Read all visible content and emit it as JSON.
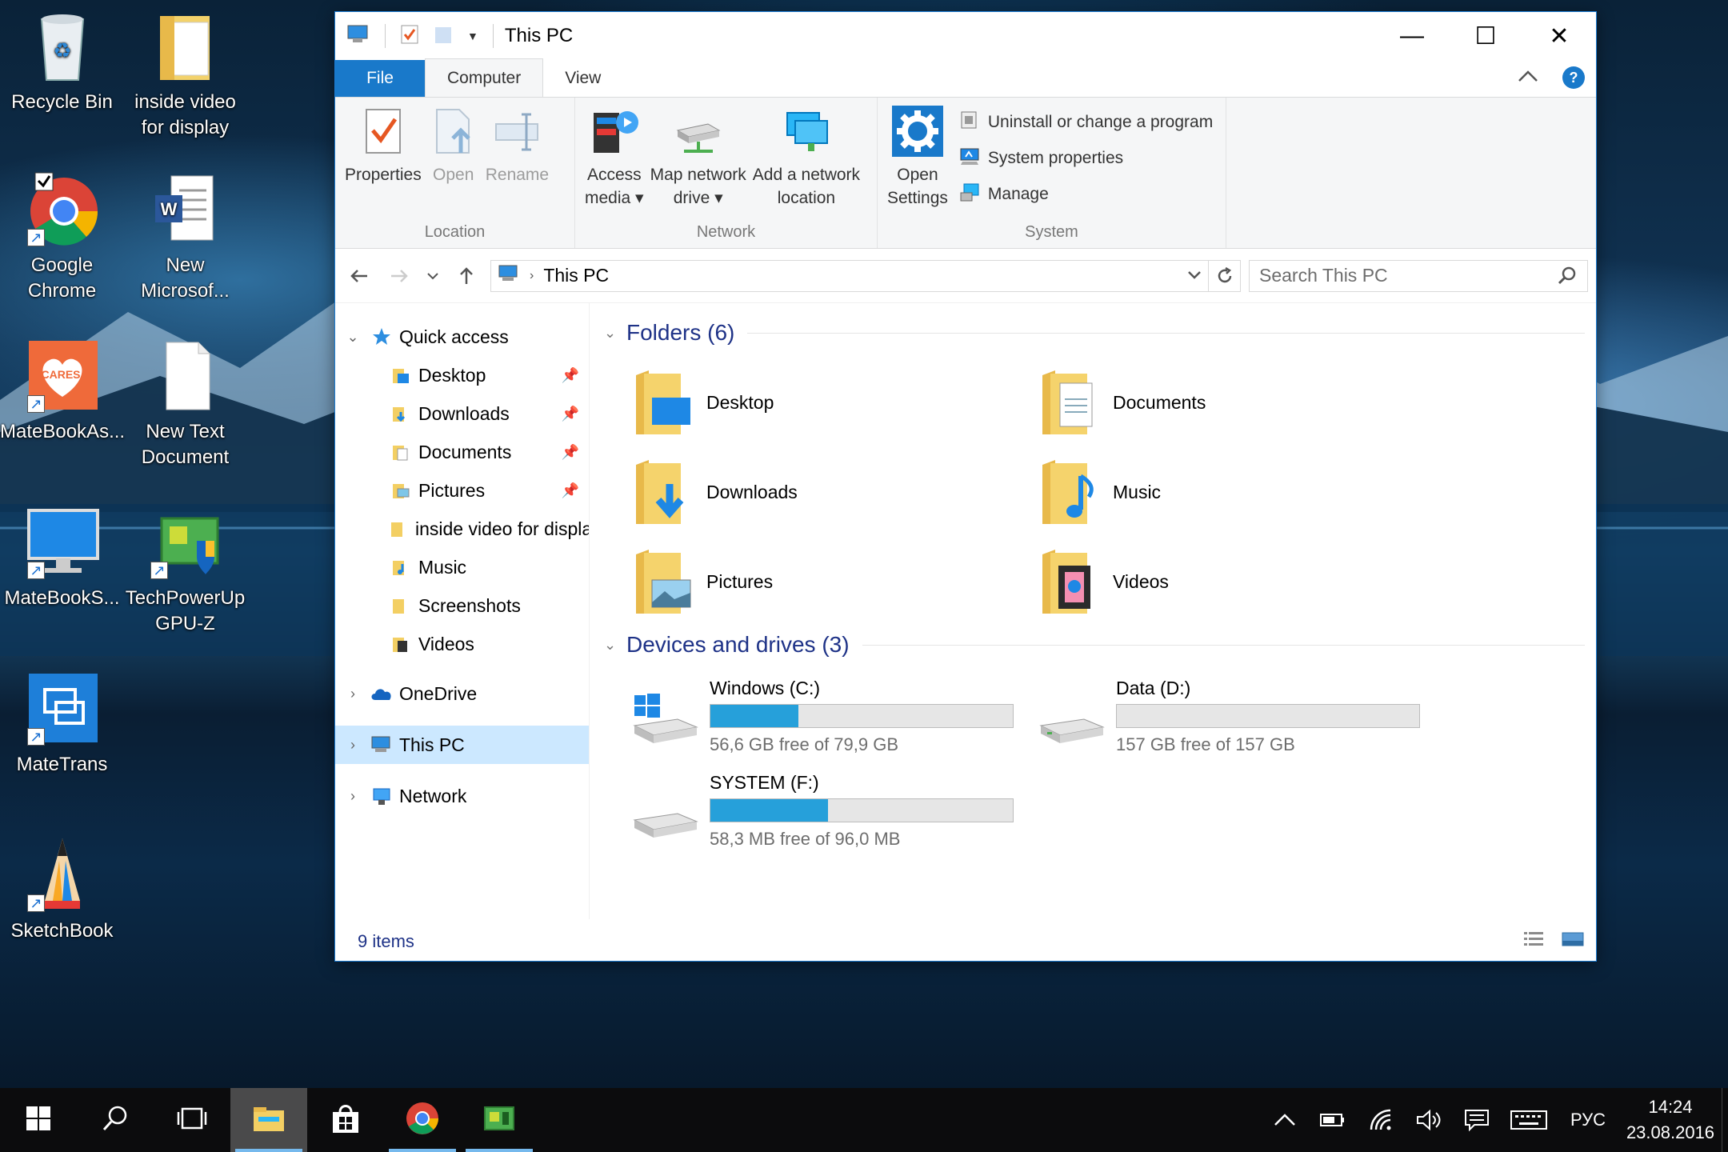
{
  "desktop": {
    "icons": [
      {
        "label": "Recycle Bin"
      },
      {
        "label": "inside video for display"
      },
      {
        "label": "Google Chrome"
      },
      {
        "label": "New Microsof..."
      },
      {
        "label": "MateBookAs..."
      },
      {
        "label": "New Text Document"
      },
      {
        "label": "MateBookS..."
      },
      {
        "label": "TechPowerUp GPU-Z"
      },
      {
        "label": "MateTrans"
      },
      {
        "label": "SketchBook"
      }
    ],
    "cares_badge": "CARES"
  },
  "window": {
    "title": "This PC",
    "controls": {
      "minimize": "—",
      "maximize": "☐",
      "close": "✕"
    },
    "tabs": [
      {
        "label": "File"
      },
      {
        "label": "Computer"
      },
      {
        "label": "View"
      }
    ],
    "help": "?",
    "ribbon": {
      "location": {
        "label": "Location",
        "buttons": [
          "Properties",
          "Open",
          "Rename"
        ]
      },
      "network": {
        "label": "Network",
        "access_media": [
          "Access",
          "media ▾"
        ],
        "map_drive": [
          "Map network",
          "drive ▾"
        ],
        "add_location": [
          "Add a network",
          "location"
        ]
      },
      "system": {
        "label": "System",
        "open_settings": [
          "Open",
          "Settings"
        ],
        "items": [
          "Uninstall or change a program",
          "System properties",
          "Manage"
        ]
      }
    },
    "address": {
      "path": "This PC",
      "search_placeholder": "Search This PC"
    },
    "nav": {
      "quick_access": "Quick access",
      "quick_items": [
        "Desktop",
        "Downloads",
        "Documents",
        "Pictures",
        "inside video for display",
        "Music",
        "Screenshots",
        "Videos"
      ],
      "onedrive": "OneDrive",
      "this_pc": "This PC",
      "network": "Network"
    },
    "folders_header": "Folders (6)",
    "folders": [
      "Desktop",
      "Documents",
      "Downloads",
      "Music",
      "Pictures",
      "Videos"
    ],
    "drives_header": "Devices and drives (3)",
    "drives": [
      {
        "name": "Windows (C:)",
        "free": "56,6 GB free of 79,9 GB",
        "used_fraction": 0.29
      },
      {
        "name": "Data (D:)",
        "free": "157 GB free of 157 GB",
        "used_fraction": 0.0
      },
      {
        "name": "SYSTEM (F:)",
        "free": "58,3 MB free of 96,0 MB",
        "used_fraction": 0.39
      }
    ],
    "status": "9 items"
  },
  "taskbar": {
    "lang": "РУС",
    "time": "14:24",
    "date": "23.08.2016"
  },
  "colors": {
    "accent": "#1979ca",
    "drive_fill": "#26a0da",
    "selection": "#cce8ff",
    "header_text": "#1e3287"
  }
}
